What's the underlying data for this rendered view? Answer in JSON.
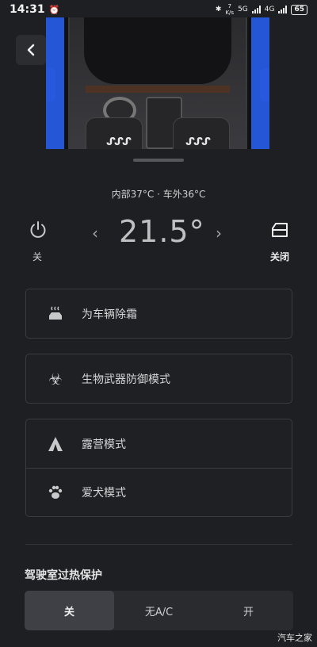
{
  "status_bar": {
    "time": "14:31",
    "network_speed_value": "7",
    "network_speed_unit": "K/s",
    "signal_1_label": "5G",
    "signal_2_label": "4G",
    "battery": "65"
  },
  "header": {
    "back_icon": "chevron-left-icon"
  },
  "climate": {
    "temperatures": "内部37°C · 车外36°C",
    "power_label": "关",
    "setpoint": "21.5°",
    "window_label": "关闭"
  },
  "modes": {
    "defrost_label": "为车辆除霜",
    "bioweapon_label": "生物武器防御模式",
    "camp_label": "露营模式",
    "dog_label": "爱犬模式"
  },
  "cabin_overheat": {
    "title": "驾驶室过热保护",
    "options": [
      "关",
      "无A/C",
      "开"
    ],
    "selected": "关"
  },
  "watermark": "汽车之家",
  "colors": {
    "background": "#1e1f22",
    "car_accent": "#2456d6"
  }
}
